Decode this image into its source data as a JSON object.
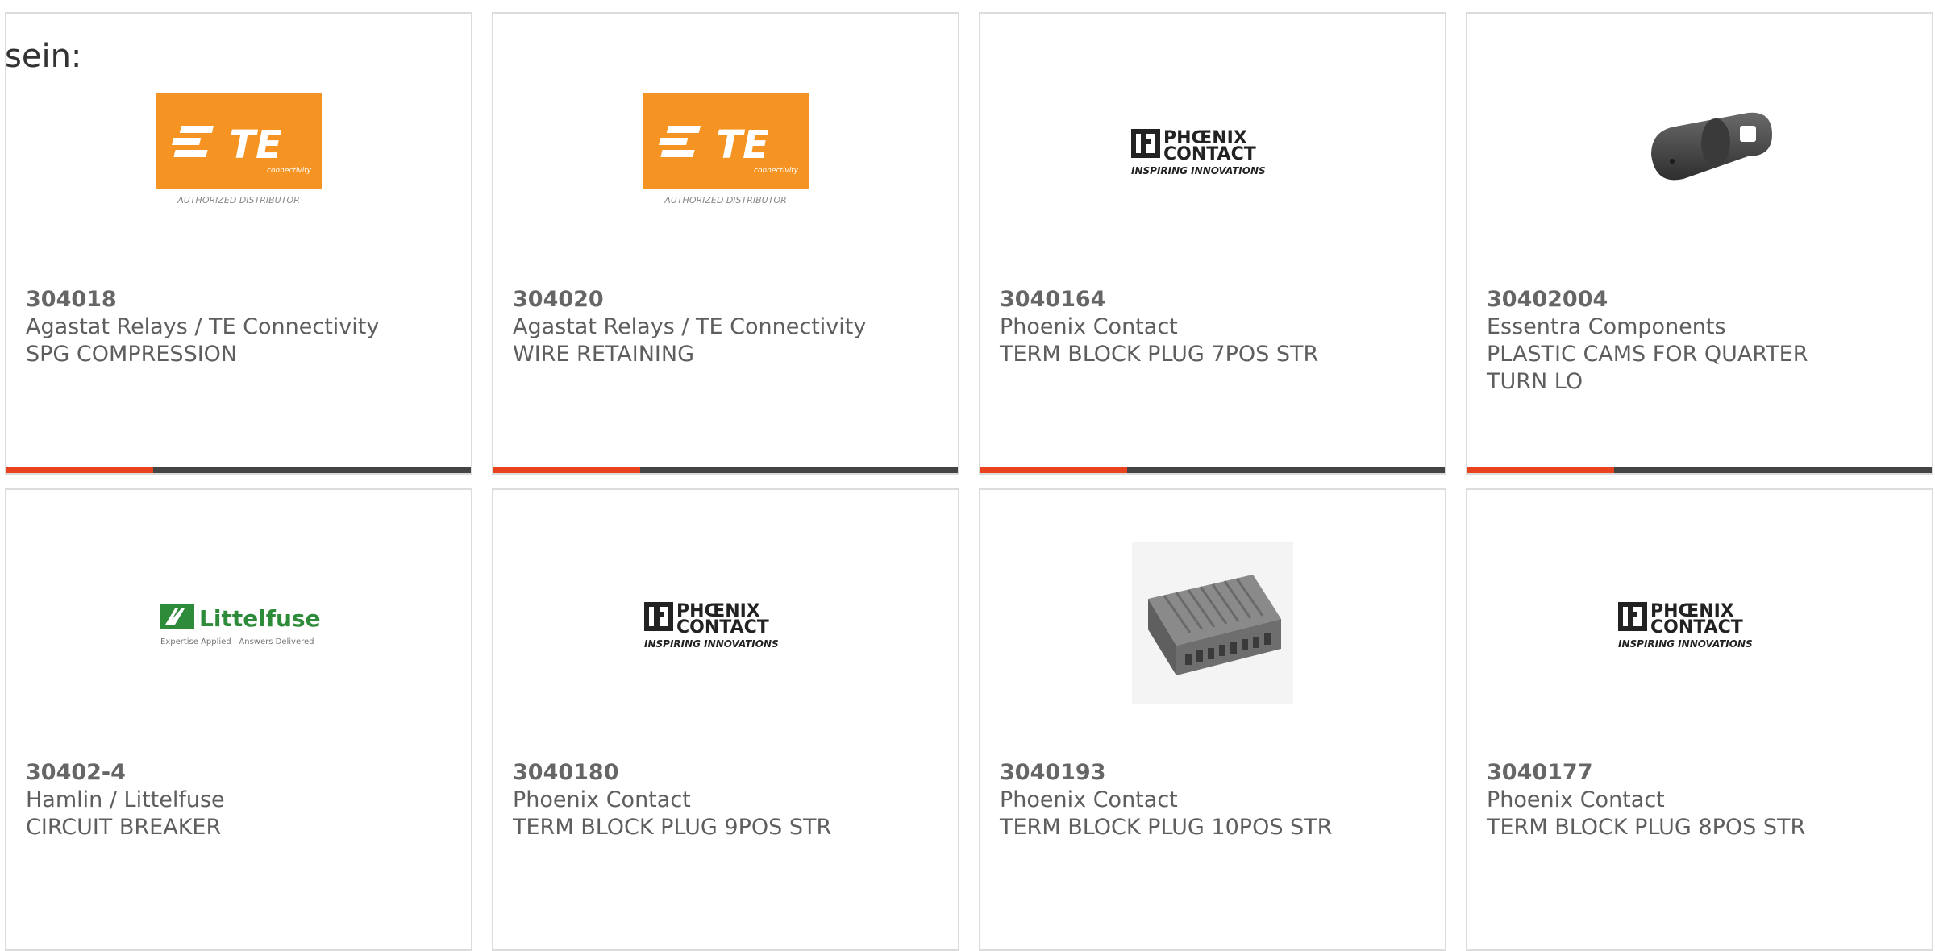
{
  "intro_text": "sein:",
  "colors": {
    "te_orange": "#f59422",
    "accent_red": "#e8431e",
    "bar_dark": "#444444",
    "littelfuse_green": "#2e8b3a",
    "card_border": "#dcdcdc"
  },
  "te_logo": {
    "wordmark": "TE",
    "sub": "connectivity",
    "tagline": "AUTHORIZED DISTRIBUTOR"
  },
  "phoenix_logo": {
    "line1": "PHŒNIX",
    "line2": "CONTACT",
    "tagline": "INSPIRING INNOVATIONS"
  },
  "littelfuse_logo": {
    "name": "Littelfuse",
    "tagline": "Expertise Applied | Answers Delivered"
  },
  "products": [
    {
      "part_number": "304018",
      "manufacturer": "Agastat Relays / TE Connectivity",
      "description": "SPG COMPRESSION",
      "image": "te-logo"
    },
    {
      "part_number": "304020",
      "manufacturer": "Agastat Relays / TE Connectivity",
      "description": "WIRE RETAINING",
      "image": "te-logo"
    },
    {
      "part_number": "3040164",
      "manufacturer": "Phoenix Contact",
      "description": "TERM BLOCK PLUG 7POS STR",
      "image": "phoenix-contact-logo"
    },
    {
      "part_number": "30402004",
      "manufacturer": "Essentra Components",
      "description": "PLASTIC CAMS FOR QUARTER TURN LO",
      "image": "plastic-cam-photo"
    },
    {
      "part_number": "30402-4",
      "manufacturer": "Hamlin / Littelfuse",
      "description": "CIRCUIT BREAKER",
      "image": "littelfuse-logo"
    },
    {
      "part_number": "3040180",
      "manufacturer": "Phoenix Contact",
      "description": "TERM BLOCK PLUG 9POS STR",
      "image": "phoenix-contact-logo"
    },
    {
      "part_number": "3040193",
      "manufacturer": "Phoenix Contact",
      "description": "TERM BLOCK PLUG 10POS STR",
      "image": "terminal-block-photo"
    },
    {
      "part_number": "3040177",
      "manufacturer": "Phoenix Contact",
      "description": "TERM BLOCK PLUG 8POS STR",
      "image": "phoenix-contact-logo"
    }
  ]
}
